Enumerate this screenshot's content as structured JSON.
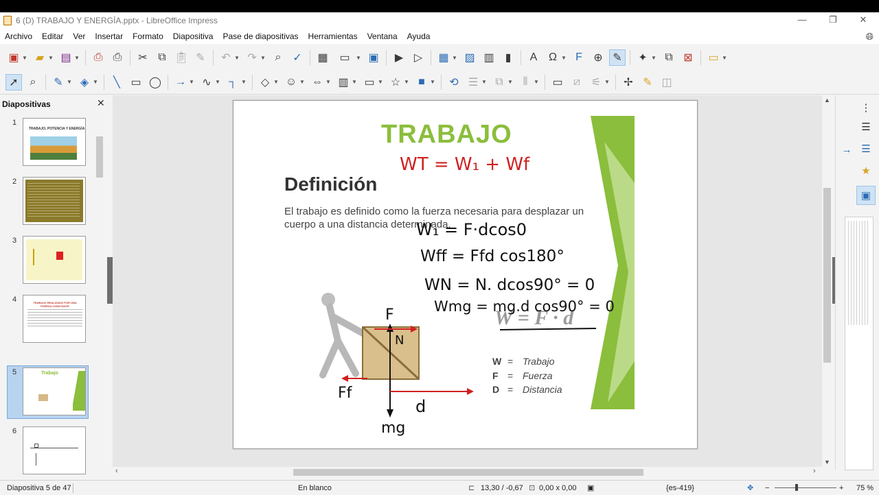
{
  "window": {
    "title": "6 (D) TRABAJO Y ENERGÍA.pptx - LibreOffice Impress",
    "minimize": "—",
    "restore": "❐",
    "close": "✕"
  },
  "menu": [
    "Archivo",
    "Editar",
    "Ver",
    "Insertar",
    "Formato",
    "Diapositiva",
    "Pase de diapositivas",
    "Herramientas",
    "Ventana",
    "Ayuda"
  ],
  "slides_pane": {
    "title": "Diapositivas",
    "close": "✕",
    "thumbnails": [
      {
        "number": "1",
        "caption": "TRABAJO, POTENCIA Y ENERGÍA"
      },
      {
        "number": "2",
        "caption": ""
      },
      {
        "number": "3",
        "caption": ""
      },
      {
        "number": "4",
        "caption": "TRABAJO REALIZADO POR UNA FUERZA CONSTANTE"
      },
      {
        "number": "5",
        "caption": "Trabajo",
        "selected": true
      },
      {
        "number": "6",
        "caption": ""
      }
    ]
  },
  "slide": {
    "title": "TRABAJO",
    "heading": "Definición",
    "body": "El  trabajo es definido como la fuerza necesaria para desplazar un cuerpo a una distancia determinada.",
    "formula": "W = F · d",
    "legend": [
      {
        "symbol": "W",
        "eq": "=",
        "meaning": "Trabajo"
      },
      {
        "symbol": "F",
        "eq": "=",
        "meaning": "Fuerza"
      },
      {
        "symbol": "D",
        "eq": "=",
        "meaning": "Distancia"
      }
    ],
    "handwriting": {
      "top_equation": "WT = W₁ + Wf",
      "line1": "W₁ = F·dcos0",
      "line2": "Wff = Ffd cos180°",
      "line3": "WN = N. dcos90° = 0",
      "line4": "Wmg = mg.d cos90° = 0",
      "label_F": "F",
      "label_N": "N",
      "label_Ff": "Ff",
      "label_d": "d",
      "label_mg": "mg",
      "zero": "0"
    }
  },
  "statusbar": {
    "slide_info": "Diapositiva 5 de 47",
    "layout": "En blanco",
    "position": "13,30 / -0,67",
    "size": "0,00 x 0,00",
    "language": "{es-419}",
    "zoom": "75 %"
  },
  "colors": {
    "accent_green": "#8bbe3c",
    "handwriting_red": "#d02020",
    "selection": "#b8d3ef"
  }
}
